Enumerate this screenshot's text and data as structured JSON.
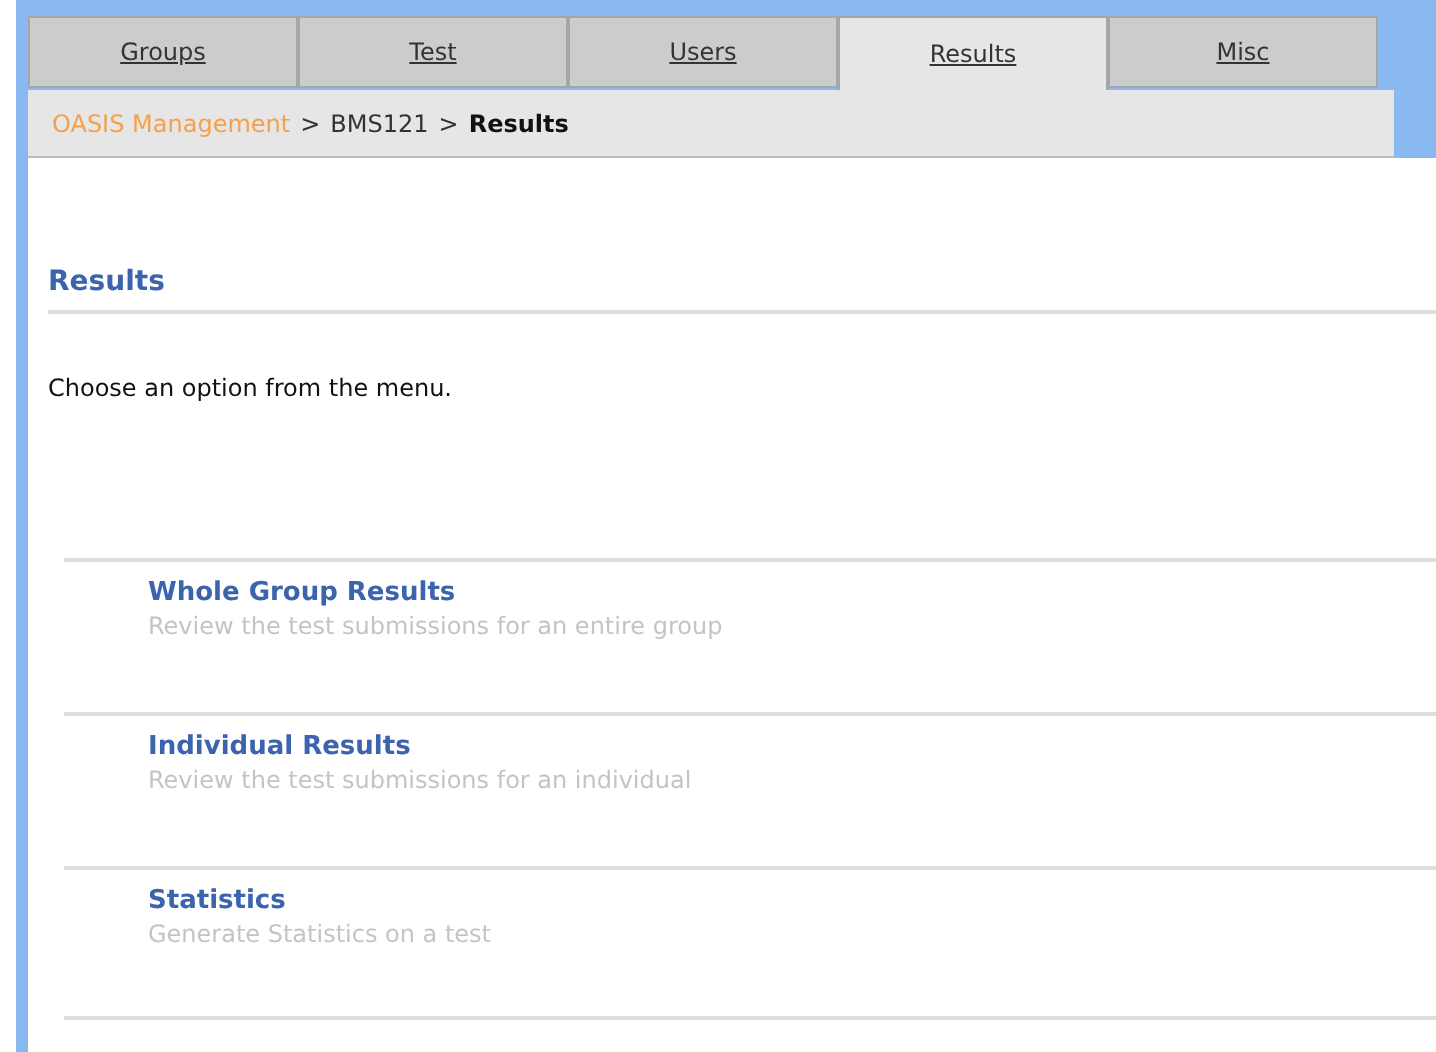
{
  "tabs": [
    {
      "label": "Groups",
      "selected": false
    },
    {
      "label": "Test",
      "selected": false
    },
    {
      "label": "Users",
      "selected": false
    },
    {
      "label": "Results",
      "selected": true
    },
    {
      "label": "Misc",
      "selected": false
    }
  ],
  "breadcrumb": {
    "links": [
      "OASIS Management",
      "BMS121"
    ],
    "separator": ">",
    "current": "Results"
  },
  "heading": "Results",
  "intro": "Choose an option from the menu.",
  "menu": [
    {
      "title": "Whole Group Results",
      "description": "Review the test submissions for an entire group"
    },
    {
      "title": "Individual Results",
      "description": "Review the test submissions for an individual"
    },
    {
      "title": "Statistics",
      "description": "Generate Statistics on a test"
    }
  ]
}
